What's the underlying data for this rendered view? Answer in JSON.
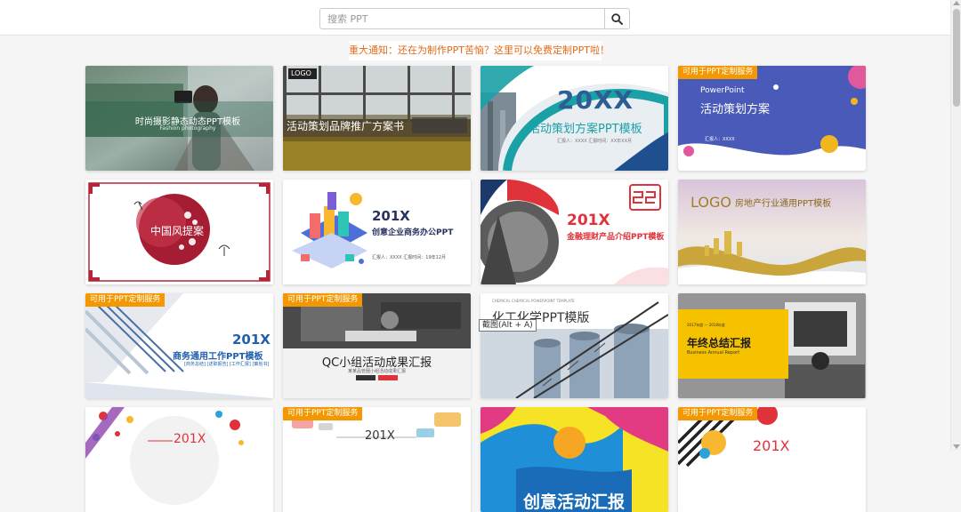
{
  "search": {
    "placeholder": "搜索 PPT",
    "button_icon": "search-icon"
  },
  "notice": {
    "text": "重大通知：还在为制作PPT苦恼？这里可以免费定制PPT啦！"
  },
  "badge_label": "可用于PPT定制服务",
  "tooltip": {
    "text": "截图(Alt + A)"
  },
  "colors": {
    "notice": "#e36b1a",
    "badge": "#f39800"
  },
  "cards": [
    {
      "title": "时尚摄影静态动态PPT模板",
      "subtitle": "Fashion photography",
      "badge": false
    },
    {
      "title": "活动策划品牌推广方案书",
      "logo": "LOGO",
      "badge": false
    },
    {
      "year": "20XX",
      "title": "活动策划方案PPT模板",
      "meta": "汇报人：XXXX  汇报时间：XX年XX月",
      "badge": false
    },
    {
      "heading": "PowerPoint",
      "title": "活动策划方案",
      "meta": "汇报人：XXXX",
      "badge": true
    },
    {
      "title": "中国风提案",
      "badge": false
    },
    {
      "year": "201X",
      "title": "创意企业商务办公PPT",
      "meta": "汇报人：XXXX   汇报时间：19年12月",
      "badge": false
    },
    {
      "year": "201X",
      "title": "金融理财产品介绍PPT模板",
      "badge": false
    },
    {
      "logo": "LOGO",
      "title": "房地产行业通用PPT模板",
      "badge": false
    },
    {
      "year": "201X",
      "title": "商务通用工作PPT模板",
      "meta": "[商务总结] [述职报告] [工作汇报] [策划书]",
      "badge": true
    },
    {
      "title": "QC小组活动成果汇报",
      "meta": "某某品管圈小组活动成果汇报",
      "badge": true
    },
    {
      "heading": "CHEMICAL CHEMICAL POWERPOINT TEMPLATE",
      "title": "化工化学PPT模版",
      "badge": false
    },
    {
      "heading": "2017年度 — 2018年度",
      "title": "年终总结汇报",
      "subtitle": "Business Annual Report",
      "badge": false
    },
    {
      "year": "201X",
      "badge": false
    },
    {
      "year": "201X",
      "badge": true
    },
    {
      "title": "创意活动汇报",
      "badge": false
    },
    {
      "year": "201X",
      "badge": true
    }
  ]
}
